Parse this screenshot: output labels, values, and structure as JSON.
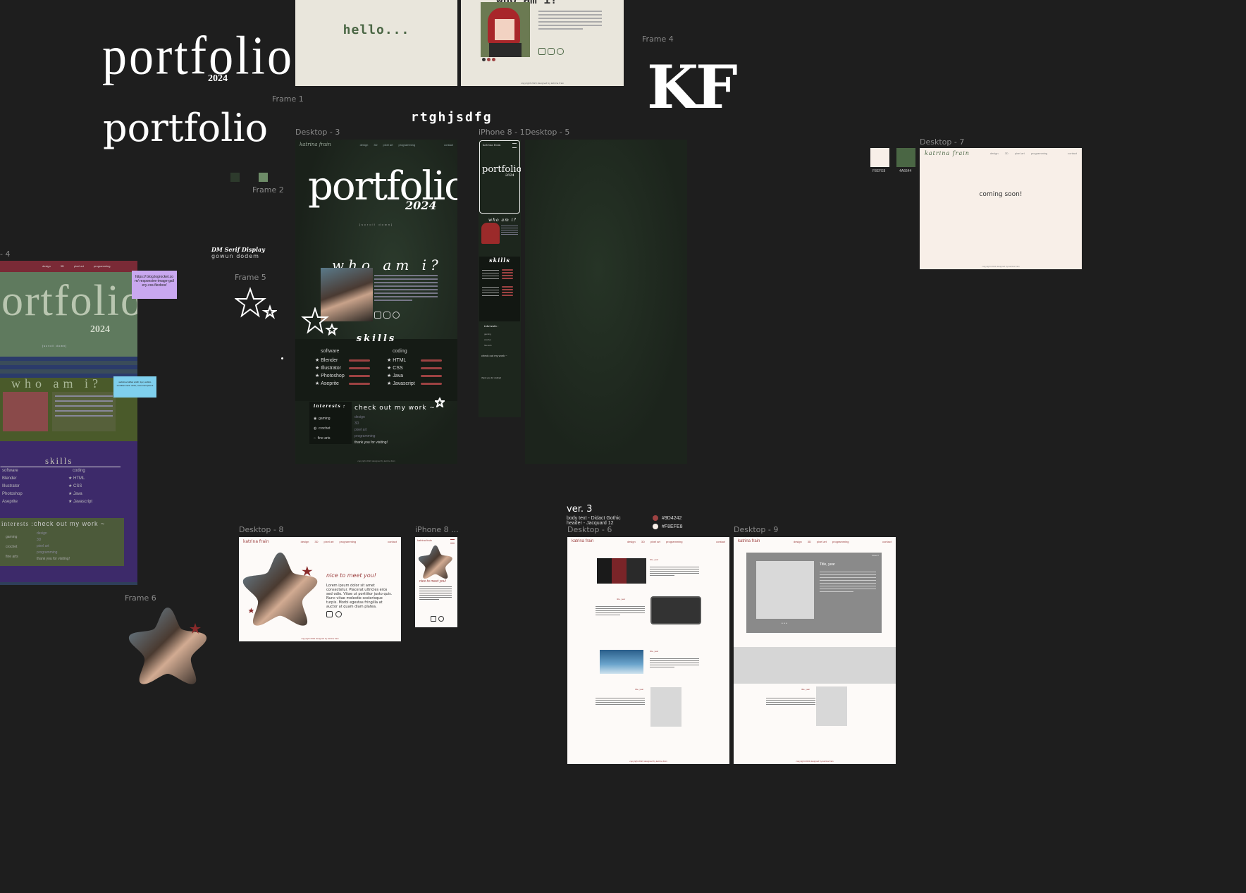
{
  "canvas": {
    "logo_portfolio_tall": "portfolio",
    "logo_year": "2024",
    "logo_portfolio_round": "portfolio",
    "rtg_text": "rtghjsdfg",
    "kf_text": "KF",
    "font_note_title": "DM Serif Display",
    "font_note_sub": "gowun dodem"
  },
  "frame_labels": {
    "frame1": "Frame 1",
    "frame2": "Frame 2",
    "frame4": "Frame 4",
    "frame5": "Frame 5",
    "frame6": "Frame 6",
    "desktop3": "Desktop - 3",
    "iphone8_1": "iPhone 8 - 1",
    "desktop5": "Desktop - 5",
    "desktop7": "Desktop - 7",
    "desktop4": "- 4",
    "desktop8": "Desktop - 8",
    "iphone8_b": "iPhone 8 ...",
    "desktop6": "Desktop - 6",
    "desktop9": "Desktop - 9"
  },
  "hello_card": {
    "text": "hello..."
  },
  "who_card": {
    "title": "who am i?",
    "footer": "copyright 2024 designed by katrina frain"
  },
  "sticky_notes": {
    "purple": "https:// blog.logrocket.com/ responsive-image-gallery-css-flexbox/",
    "blue": "webkit-scrollbar width: 1px; webkit-scrollbar-track: white; color:transparent"
  },
  "desktop3": {
    "brand": "katrina frain",
    "nav": [
      "design",
      "3D",
      "pixel art",
      "programming"
    ],
    "contact": "contact",
    "hero_title": "portfolio",
    "hero_year": "2024",
    "scroll": "[scroll down]",
    "who_title": "who am i?",
    "skills_title": "skills",
    "software_head": "software",
    "software": [
      "Blender",
      "Illustrator",
      "Photoshop",
      "Aseprite"
    ],
    "coding_head": "coding",
    "coding": [
      "HTML",
      "CSS",
      "Java",
      "Javascript"
    ],
    "interests_title": "interests :",
    "interests": [
      "gaming",
      "crochet",
      "fine arts"
    ],
    "work_title": "check out my work ~",
    "work_links": [
      "design",
      "3D",
      "pixel art",
      "programming"
    ],
    "thanks": "thank you for visiting!",
    "footer": "copyright 2024 designed by katrina frain"
  },
  "iphone1": {
    "brand": "katrina frain",
    "hero_title": "portfolio",
    "hero_year": "2024",
    "who_title": "who am i?",
    "skills_title": "skills",
    "interests_title": "interests :",
    "interests": [
      "gaming",
      "crochet",
      "fine arts"
    ],
    "work_title": "check out my work ~",
    "thanks": "thank you for visiting!"
  },
  "desktop7": {
    "swatches": [
      {
        "hex": "#F8EFE8",
        "label": "F8EFE8"
      },
      {
        "hex": "#4A6644",
        "label": "4A6644"
      }
    ],
    "brand": "katrina frain",
    "nav": [
      "design",
      "3D",
      "pixel art",
      "programming"
    ],
    "contact": "contact",
    "message": "coming soon!",
    "footer": "copyright 2024 designed by katrina frain"
  },
  "desktop4_old": {
    "nav": [
      "design",
      "3D",
      "pixel art",
      "programming"
    ],
    "hero_title": "ortfolio",
    "hero_year": "2024",
    "scroll": "[scroll down]",
    "who_title": "who am i?",
    "skills_title": "skills",
    "software_head": "software",
    "software": [
      "Blender",
      "Illustrator",
      "Photoshop",
      "Aseprite"
    ],
    "coding_head": "coding",
    "coding": [
      "HTML",
      "CSS",
      "Java",
      "Javascript"
    ],
    "interests_title": "interests :",
    "interests": [
      "gaming",
      "crochet",
      "fine arts"
    ],
    "work_title": "check out my work ~",
    "work_links": [
      "design",
      "3D",
      "pixel art",
      "programming"
    ],
    "thanks": "thank you for visiting!"
  },
  "desktop8": {
    "brand": "katrina frain",
    "nav": [
      "design",
      "3D",
      "pixel art",
      "programming"
    ],
    "contact": "contact",
    "heading": "nice to meet you!",
    "body": "Lorem ipsum dolor sit amet consectetur. Placerat ultricies eros sed odio. Vitae ut porttitor justo quis. Nunc vitae molestie scelerisque turpis. Morbi egestas fringilla at auctor at quam diam platea.",
    "footer": "copyright 2024 designed by katrina frain"
  },
  "iphone8b": {
    "brand": "katrina frain",
    "heading": "nice to meet you!"
  },
  "ver3": {
    "title": "ver. 3",
    "body_font": "body text -  Didact Gothic",
    "header_font": "header -  Jacquard 12",
    "colors": [
      {
        "hex": "#9D4242",
        "label": "#9D4242"
      },
      {
        "hex": "#F8EFE8",
        "label": "#F8EFE8"
      }
    ]
  },
  "desktop6": {
    "brand": "katrina frain",
    "nav": [
      "design",
      "3D",
      "pixel art",
      "programming"
    ],
    "contact": "contact",
    "item_title": "title, year",
    "footer": "copyright 2024 designed by katrina frain"
  },
  "desktop9": {
    "brand": "katrina frain",
    "nav": [
      "design",
      "3D",
      "pixel art",
      "programming"
    ],
    "contact": "contact",
    "modal_title": "Title, year",
    "modal_close": "close X",
    "item_title": "title, year",
    "footer": "copyright 2024 designed by katrina frain"
  },
  "colors": {
    "accent_red": "#9D4242",
    "cream": "#F8EFE8",
    "green": "#4A6644",
    "canvas_bg": "#1E1E1E"
  }
}
